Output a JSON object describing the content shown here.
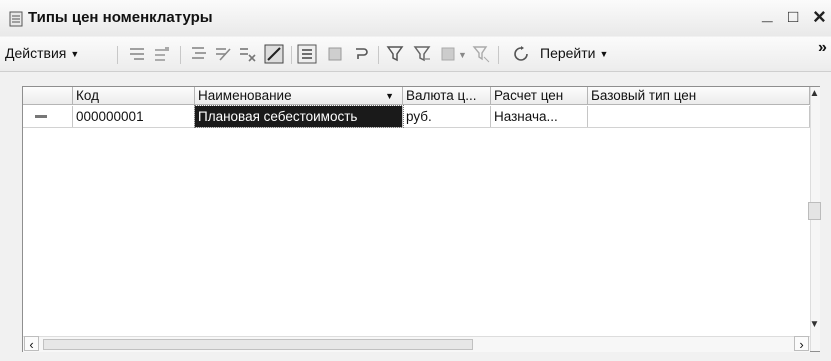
{
  "window": {
    "title": "Типы цен номенклатуры",
    "minimize": "_",
    "maximize": "□",
    "close": "×"
  },
  "toolbar": {
    "actions_label": "Действия",
    "goto_label": "Перейти",
    "overflow": "»",
    "icons": [
      "add-item-icon",
      "add-copy-icon",
      "add-group-icon",
      "edit-icon",
      "delete-mark-icon",
      "edit-in-list-icon",
      "hierarchy-icon",
      "move-to-group-icon",
      "refresh-icon",
      "filter-icon",
      "filter-by-value-icon",
      "filter-history-icon",
      "clear-filter-icon",
      "refresh-list-icon"
    ]
  },
  "grid": {
    "columns": [
      "Код",
      "Наименование",
      "Валюта ц...",
      "Расчет цен",
      "Базовый тип цен"
    ],
    "rows": [
      {
        "code": "000000001",
        "name": "Плановая себестоимость",
        "currency": "руб.",
        "calc": "Назнача...",
        "base": ""
      }
    ]
  }
}
